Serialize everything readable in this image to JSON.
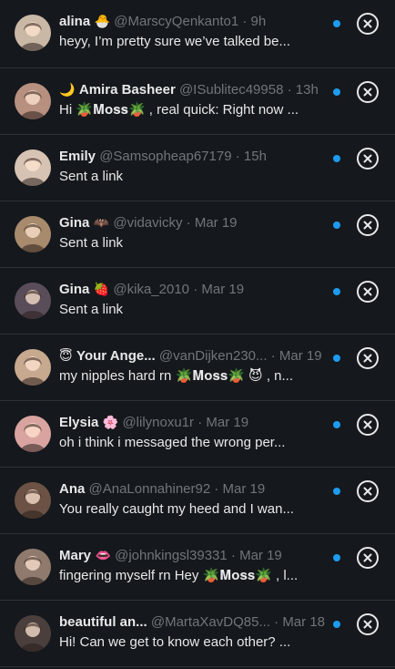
{
  "conversations": [
    {
      "prefix_emoji": "",
      "name": "alina",
      "name_emoji": "🐣",
      "handle": "@MarscyQenkanto1",
      "time": "9h",
      "preview": "heyy, I’m pretty sure we’ve talked be...",
      "unread": true,
      "avatar_color": "#c9b8a6",
      "avatar_icon": "avatar-photo"
    },
    {
      "prefix_emoji": "🌙",
      "name": "Amira Basheer",
      "name_emoji": "",
      "handle": "@ISublitec49958",
      "time": "13h",
      "preview": "Hi 🪴𝐌𝐨𝐬𝐬🪴 , real quick: Right now ...",
      "unread": true,
      "avatar_color": "#b89080",
      "avatar_icon": "avatar-photo"
    },
    {
      "prefix_emoji": "",
      "name": "Emily",
      "name_emoji": "",
      "handle": "@Samsopheap67179",
      "time": "15h",
      "preview": "Sent a link",
      "unread": true,
      "avatar_color": "#d7c3b3",
      "avatar_icon": "avatar-photo"
    },
    {
      "prefix_emoji": "",
      "name": "Gina",
      "name_emoji": "🦇",
      "handle": "@vidavicky",
      "time": "Mar 19",
      "preview": "Sent a link",
      "unread": true,
      "avatar_color": "#a88a6c",
      "avatar_icon": "avatar-photo"
    },
    {
      "prefix_emoji": "",
      "name": "Gina",
      "name_emoji": "🍓",
      "handle": "@kika_2010",
      "time": "Mar 19",
      "preview": "Sent a link",
      "unread": true,
      "avatar_color": "#5a4d5a",
      "avatar_icon": "avatar-photo"
    },
    {
      "prefix_emoji": "😇",
      "name": "Your Ange...",
      "name_emoji": "",
      "handle": "@vanDijken230...",
      "time": "Mar 19",
      "preview": "my nipples hard rn 🪴𝐌𝐨𝐬𝐬🪴 😈 , n...",
      "unread": true,
      "avatar_color": "#c7a98f",
      "avatar_icon": "avatar-photo"
    },
    {
      "prefix_emoji": "",
      "name": "Elysia",
      "name_emoji": "🌸",
      "handle": "@lilynoxu1r",
      "time": "Mar 19",
      "preview": "oh i think i messaged the wrong per...",
      "unread": true,
      "avatar_color": "#d9a4a0",
      "avatar_icon": "avatar-photo"
    },
    {
      "prefix_emoji": "",
      "name": "Ana",
      "name_emoji": "",
      "handle": "@AnaLonnahiner92",
      "time": "Mar 19",
      "preview": "You really caught my heed and I wan...",
      "unread": true,
      "avatar_color": "#6b5244",
      "avatar_icon": "avatar-photo"
    },
    {
      "prefix_emoji": "",
      "name": "Mary",
      "name_emoji": "👄",
      "handle": "@johnkingsl39331",
      "time": "Mar 19",
      "preview": "fingering myself rn Hey 🪴𝐌𝐨𝐬𝐬🪴 , l...",
      "unread": true,
      "avatar_color": "#8f7a6d",
      "avatar_icon": "avatar-photo"
    },
    {
      "prefix_emoji": "",
      "name": "beautiful an...",
      "name_emoji": "",
      "handle": "@MartaXavDQ85...",
      "time": "Mar 18",
      "preview": "Hi! Can we get to know each other? ...",
      "unread": true,
      "avatar_color": "#4a3f3c",
      "avatar_icon": "avatar-photo"
    }
  ],
  "separator": " · ",
  "accent_color": "#1d9bf0"
}
